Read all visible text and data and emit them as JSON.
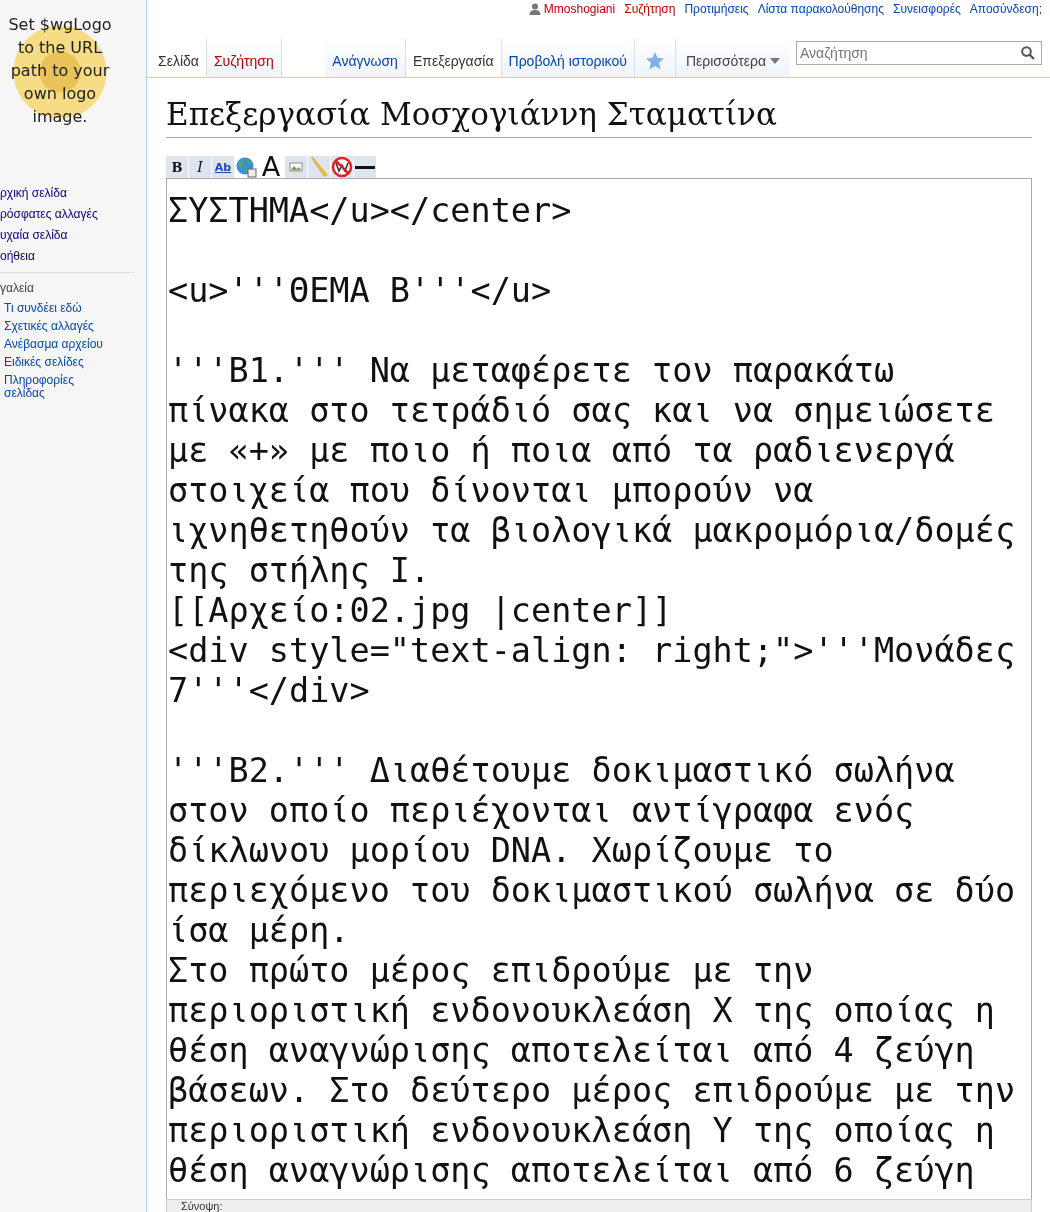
{
  "personal_tools": [
    {
      "label": "Mmoshogiani",
      "new": true,
      "kind": "user"
    },
    {
      "label": "Συζήτηση",
      "new": true,
      "kind": "link"
    },
    {
      "label": "Προτιμήσεις",
      "new": false,
      "kind": "link"
    },
    {
      "label": "Λίστα παρακολούθησης",
      "new": false,
      "kind": "link"
    },
    {
      "label": "Συνεισφορές",
      "new": false,
      "kind": "link"
    },
    {
      "label": "Αποσύνδεση;",
      "new": false,
      "kind": "link"
    }
  ],
  "logo": {
    "text": "Set $wgLogo to the URL path to your own logo image."
  },
  "sidebar": {
    "navigation": [
      "ρχική σελίδα",
      "ρόσφατες αλλαγές",
      "υχαία σελίδα",
      "οήθεια"
    ],
    "tools_heading": "γαλεία",
    "tools": [
      "Τι συνδέει εδώ",
      "Σχετικές αλλαγές",
      "Ανέβασμα αρχείου",
      "Ειδικές σελίδες",
      "Πληροφορίες σελίδας"
    ]
  },
  "namespace_tabs": [
    {
      "label": "Σελίδα",
      "selected": true,
      "new": false
    },
    {
      "label": "Συζήτηση",
      "selected": false,
      "new": true
    }
  ],
  "view_tabs": [
    {
      "label": "Ανάγνωση",
      "selected": false
    },
    {
      "label": "Επεξεργασία",
      "selected": true
    },
    {
      "label": "Προβολή ιστορικού",
      "selected": false
    }
  ],
  "watch": {
    "on": false
  },
  "more_menu": {
    "label": "Περισσότερα"
  },
  "search": {
    "placeholder": "Αναζήτηση"
  },
  "heading": "Επεξεργασία Μοσχογιάννη Σταματίνα",
  "toolbar": [
    {
      "kind": "bold",
      "glyph": "B"
    },
    {
      "kind": "italic",
      "glyph": "I"
    },
    {
      "kind": "link",
      "glyph": "Ab"
    },
    {
      "kind": "globe"
    },
    {
      "kind": "headline",
      "glyph": "A"
    },
    {
      "kind": "image"
    },
    {
      "kind": "media"
    },
    {
      "kind": "nowiki"
    },
    {
      "kind": "rule"
    }
  ],
  "editor_blocks": [
    [
      "ΣΥΣΤΗΜΑ</u></center>"
    ],
    [
      "<u>'''ΘΕΜΑ Β'''</u>"
    ],
    [
      "'''Β1.''' Να μεταφέρετε τον παρακάτω",
      "πίνακα στο τετράδιό σας και να σημειώσετε",
      "με «+» με ποιο ή ποια από τα ραδιενεργά",
      "στοιχεία που δίνονται μπορούν να",
      "ιχνηθετηθούν τα βιολογικά μακρομόρια/δομές",
      "της στήλης Ι.",
      "[[Αρχείο:02.jpg |center]]",
      "<div style=\"text-align: right;\">'''Μονάδες",
      "7'''</div>"
    ],
    [
      "'''Β2.''' Διαθέτουμε δοκιμαστικό σωλήνα",
      "στον οποίο περιέχονται αντίγραφα ενός",
      "δίκλωνου μορίου DNA. Χωρίζουμε το",
      "περιεχόμενο του δοκιμαστικού σωλήνα σε δύο",
      "ίσα μέρη.",
      "Στο πρώτο μέρος επιδρούμε με την",
      "περιοριστική ενδονουκλεάση Χ της οποίας η",
      "θέση αναγνώρισης αποτελείται από 4 ζεύγη",
      "βάσεων. Στο δεύτερο μέρος επιδρούμε με την",
      "περιοριστική ενδονουκλεάση Υ της οποίας η",
      "θέση αναγνώρισης αποτελείται από 6 ζεύγη"
    ]
  ],
  "summary": {
    "label": "Σύνοψη:"
  }
}
